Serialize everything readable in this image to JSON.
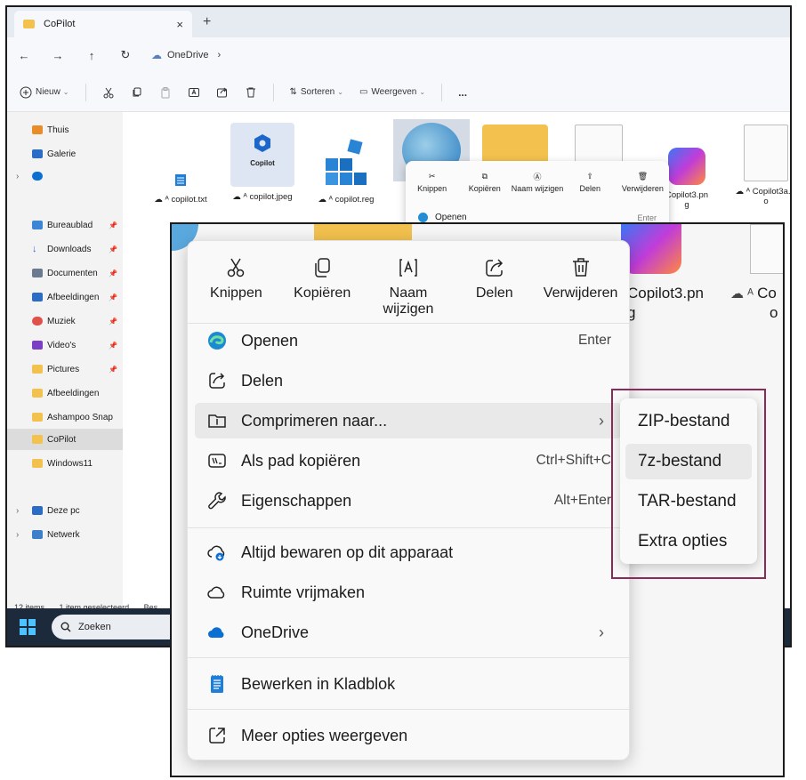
{
  "explorer": {
    "tab_title": "CoPilot",
    "tab_close": "×",
    "new_tab": "+",
    "address": "OneDrive",
    "toolbar": {
      "new_label": "Nieuw",
      "sort_label": "Sorteren",
      "view_label": "Weergeven",
      "more": "..."
    },
    "sidebar": {
      "items": [
        {
          "label": "Thuis"
        },
        {
          "label": "Galerie"
        },
        {
          "label": "Bureaublad"
        },
        {
          "label": "Downloads"
        },
        {
          "label": "Documenten"
        },
        {
          "label": "Afbeeldingen"
        },
        {
          "label": "Muziek"
        },
        {
          "label": "Video's"
        },
        {
          "label": "Pictures"
        },
        {
          "label": "Afbeeldingen"
        },
        {
          "label": "Ashampoo Snap"
        },
        {
          "label": "CoPilot"
        },
        {
          "label": "Windows11"
        },
        {
          "label": "Deze pc"
        },
        {
          "label": "Netwerk"
        }
      ]
    },
    "files": [
      {
        "name": "copilot.txt"
      },
      {
        "name": "copilot.jpeg",
        "thumb_label": "Copilot"
      },
      {
        "name": "copilot.reg"
      },
      {
        "name": "Copilot3.pn",
        "name2": "g"
      },
      {
        "name": "Copilot3a.ic",
        "name2": "o"
      }
    ],
    "status": {
      "count": "12 items",
      "selected": "1 item geselecteerd",
      "extra": "Bes"
    },
    "taskbar": {
      "search_placeholder": "Zoeken"
    }
  },
  "mini_menu": {
    "actions": [
      "Knippen",
      "Kopiëren",
      "Naam wijzigen",
      "Delen",
      "Verwijderen"
    ],
    "open_label": "Openen",
    "open_shortcut": "Enter"
  },
  "context_menu": {
    "actions": {
      "cut": "Knippen",
      "copy": "Kopiëren",
      "rename": "Naam wijzigen",
      "share": "Delen",
      "delete": "Verwijderen"
    },
    "items": {
      "open": {
        "label": "Openen",
        "shortcut": "Enter"
      },
      "share": {
        "label": "Delen"
      },
      "compress": {
        "label": "Comprimeren naar..."
      },
      "copy_path": {
        "label": "Als pad kopiëren",
        "shortcut": "Ctrl+Shift+C"
      },
      "properties": {
        "label": "Eigenschappen",
        "shortcut": "Alt+Enter"
      },
      "keep": {
        "label": "Altijd bewaren op dit apparaat"
      },
      "free": {
        "label": "Ruimte vrijmaken"
      },
      "onedrive": {
        "label": "OneDrive"
      },
      "notepad": {
        "label": "Bewerken in Kladblok"
      },
      "more": {
        "label": "Meer opties weergeven"
      }
    },
    "submenu_arrow": "›"
  },
  "submenu": {
    "items": [
      "ZIP-bestand",
      "7z-bestand",
      "TAR-bestand",
      "Extra opties"
    ]
  },
  "zoom_bg": {
    "file_label": "Copilot3.pn",
    "file_label2": "g",
    "file2_label": "Co",
    "file2_label2": "o"
  },
  "colors": {
    "accent": "#0067c0",
    "highlight_outline": "#8a2b5a",
    "taskbar": "#1c2a3b"
  }
}
